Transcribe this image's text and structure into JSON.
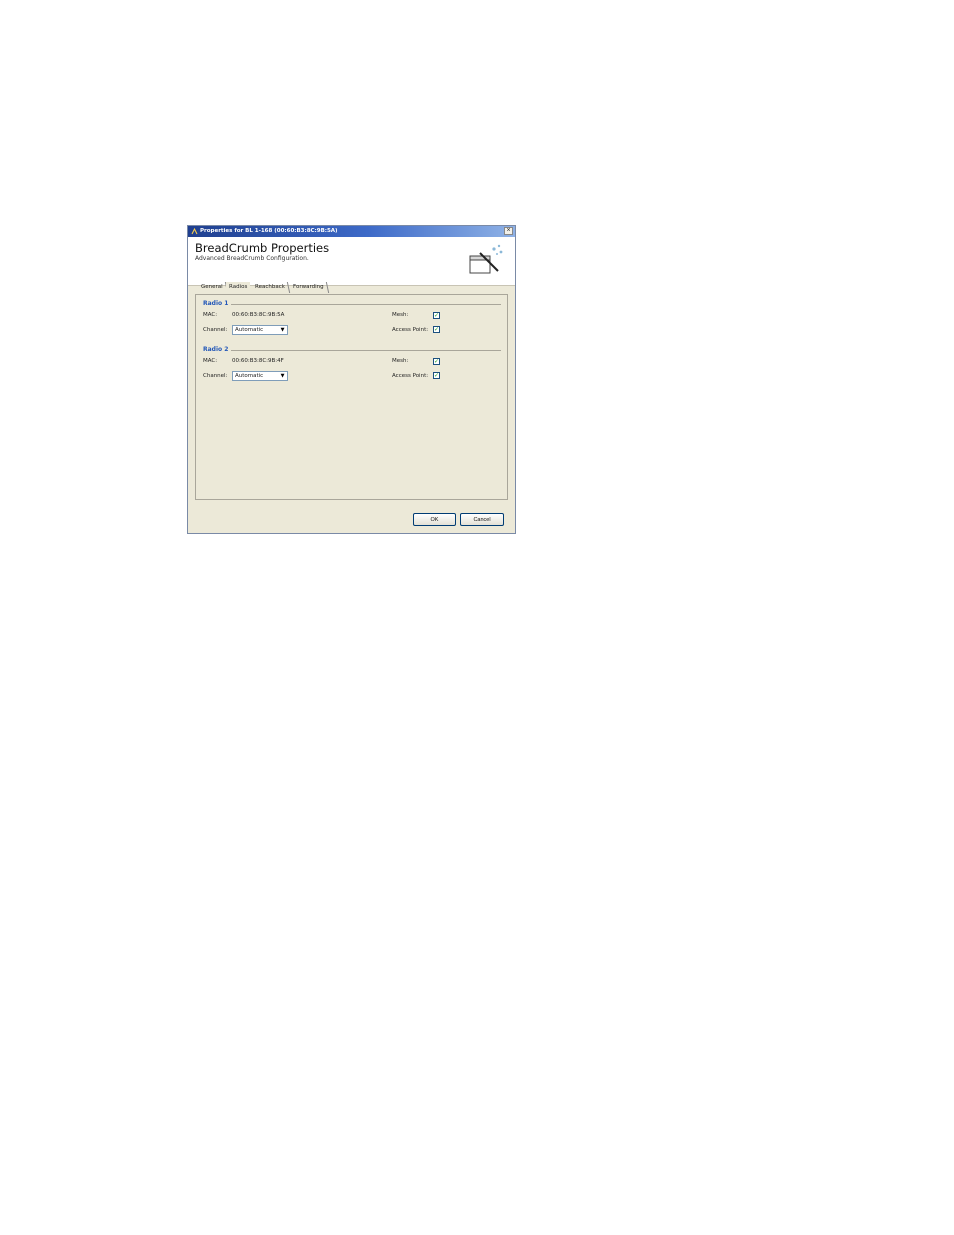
{
  "window": {
    "title": "Properties for BL 1-168 (00:60:B3:8C:9B:5A)",
    "close_label": "×"
  },
  "header": {
    "title": "BreadCrumb Properties",
    "subtitle": "Advanced BreadCrumb Configuration."
  },
  "tabs": [
    {
      "label": "General",
      "active": false
    },
    {
      "label": "Radios",
      "active": true
    },
    {
      "label": "Reachback",
      "active": false
    },
    {
      "label": "Forwarding",
      "active": false
    }
  ],
  "radio1": {
    "title": "Radio 1",
    "mac_label": "MAC:",
    "mac_value": "00:60:B3:8C:9B:5A",
    "channel_label": "Channel:",
    "channel_value": "Automatic",
    "mesh_label": "Mesh:",
    "mesh_checked": true,
    "ap_label": "Access Point:",
    "ap_checked": true
  },
  "radio2": {
    "title": "Radio 2",
    "mac_label": "MAC:",
    "mac_value": "00:60:B3:8C:9B:4F",
    "channel_label": "Channel:",
    "channel_value": "Automatic",
    "mesh_label": "Mesh:",
    "mesh_checked": true,
    "ap_label": "Access Point:",
    "ap_checked": true
  },
  "icons": {
    "dropdown_arrow": "▼",
    "check": "✓"
  },
  "buttons": {
    "ok": "OK",
    "cancel": "Cancel"
  },
  "colors": {
    "titlebar": "#1f3f8f",
    "section_title": "#2458b8",
    "dialog_bg": "#ece9d8"
  }
}
